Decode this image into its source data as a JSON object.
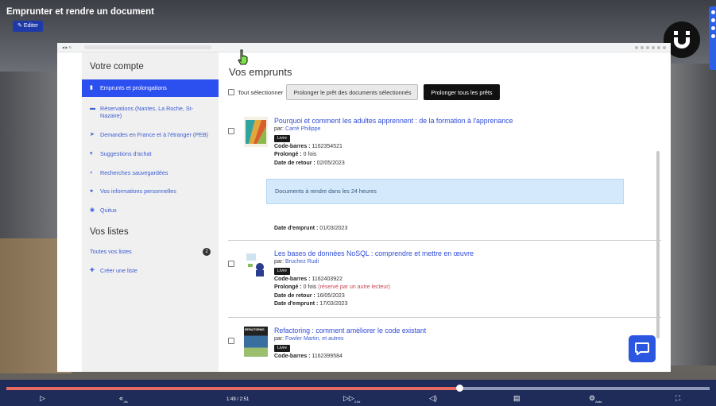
{
  "video": {
    "title": "Emprunter et rendre un document",
    "edit_label": "Editer",
    "time": "1:49 / 2:51",
    "progress": 0.644
  },
  "sidebar": {
    "account_heading": "Votre compte",
    "items": [
      {
        "icon": "book-icon",
        "label": "Emprunts et prolongations",
        "active": true
      },
      {
        "icon": "briefcase-icon",
        "label": "Réservations (Nantes, La Roche, St-Nazaire)"
      },
      {
        "icon": "paper-plane-icon",
        "label": "Demandes en France et à l'étranger (PEB)"
      },
      {
        "icon": "cart-icon",
        "label": "Suggestions d'achat"
      },
      {
        "icon": "search-icon",
        "label": "Recherches sauvegardées"
      },
      {
        "icon": "user-icon",
        "label": "Vos informations personnelles"
      },
      {
        "icon": "eye-icon",
        "label": "Quitus"
      }
    ],
    "lists_heading": "Vos listes",
    "lists": {
      "all_label": "Toutes vos listes",
      "count": "2",
      "create_label": "Créer une liste"
    }
  },
  "main": {
    "title": "Vos emprunts",
    "select_all": "Tout sélectionner",
    "extend_selected": "Prolonger le prêt des documents sélectionnés",
    "extend_all": "Prolonger tous les prêts",
    "labels": {
      "by": "par:",
      "barcode": "Code-barres :",
      "extended": "Prolongé :",
      "return_date": "Date de retour :",
      "loan_date": "Date d'emprunt :"
    },
    "documents": [
      {
        "title": "Pourquoi et comment les adultes apprennent : de la formation à l'apprenance",
        "author": "Carré Philippe",
        "type": "Livre",
        "barcode": "1162354521",
        "extended": "0 fois",
        "extended_note": "",
        "return_date": "02/05/2023",
        "alert": "Documents à rendre dans les 24 heures",
        "loan_date": "01/03/2023"
      },
      {
        "title": "Les bases de données NoSQL : comprendre et mettre en œuvre",
        "author": "Bruchez Rudi",
        "type": "Livre",
        "barcode": "1162403922",
        "extended": "0 fois",
        "extended_note": "(réservé par un autre lecteur)",
        "return_date": "16/05/2023",
        "loan_date": "17/03/2023"
      },
      {
        "title": "Refactoring : comment améliorer le code existant",
        "author": "Fowler Martin, et autres",
        "type": "Livre",
        "barcode": "1162399584",
        "cover_text": "REFACTORING"
      }
    ]
  },
  "player": {
    "rewind_label": "-5s",
    "speed_label": "1.0x",
    "quality_label": "Auto"
  }
}
